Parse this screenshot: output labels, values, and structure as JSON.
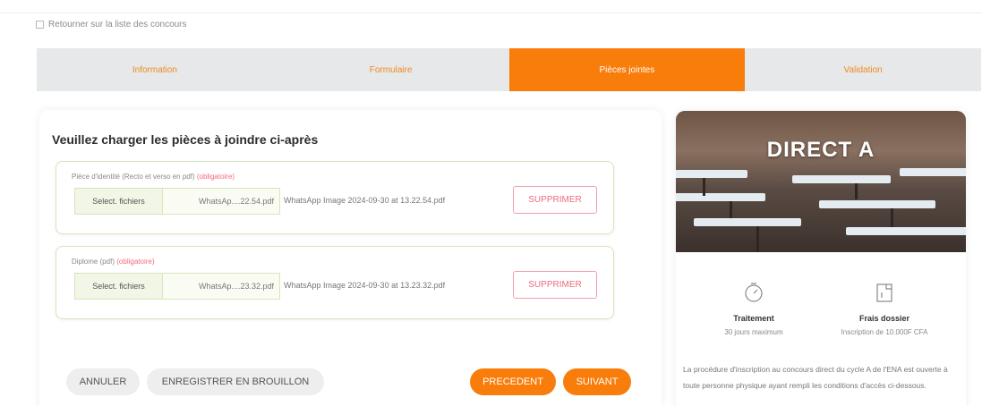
{
  "back_link": {
    "label": "Retourner sur la liste des concours"
  },
  "steps": [
    {
      "label": "Information",
      "active": false
    },
    {
      "label": "Formulaire",
      "active": false
    },
    {
      "label": "Pièces jointes",
      "active": true
    },
    {
      "label": "Validation",
      "active": false
    }
  ],
  "form": {
    "title": "Veuillez charger les pièces à joindre ci-après",
    "uploads": [
      {
        "label": "Pièce d'identité (Recto et verso en pdf)",
        "required": "(obligatoire)",
        "select_label": "Select. fichiers",
        "file_short": "WhatsAp....22.54.pdf",
        "file_full": "WhatsApp Image 2024-09-30 at 13.22.54.pdf",
        "delete_label": "SUPPRIMER"
      },
      {
        "label": "Diplome (pdf)",
        "required": "(obligatoire)",
        "select_label": "Select. fichiers",
        "file_short": "WhatsAp....23.32.pdf",
        "file_full": "WhatsApp Image 2024-09-30 at 13.23.32.pdf",
        "delete_label": "SUPPRIMER"
      }
    ]
  },
  "actions": {
    "cancel": "ANNULER",
    "save_draft": "ENREGISTRER EN BROUILLON",
    "previous": "PRECEDENT",
    "next": "SUIVANT"
  },
  "side": {
    "title": "DIRECT A",
    "processing": {
      "title": "Traitement",
      "value": "30 jours maximum"
    },
    "fees": {
      "title": "Frais dossier",
      "value": "Inscription de 10.000F CFA"
    },
    "description": "La procédure d'inscription au concours direct du cycle A de l'ENA est ouverte à toute personne physique ayant rempli les conditions d'accès ci-dessous."
  },
  "colors": {
    "accent": "#f97d0b",
    "danger": "#ef6a7c",
    "upload_border": "#d5e6b8"
  }
}
